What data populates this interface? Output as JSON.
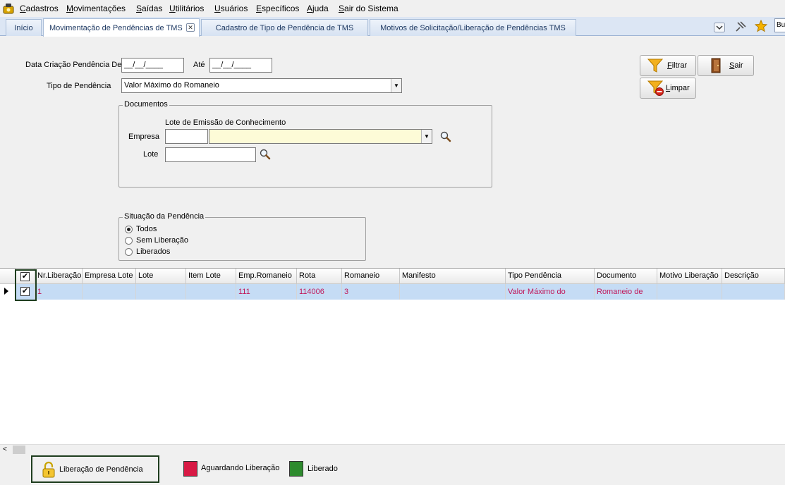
{
  "menu": {
    "items": [
      "Cadastros",
      "Movimentações",
      "Saídas",
      "Utilitários",
      "Usuários",
      "Específicos",
      "Ajuda",
      "Sair do Sistema"
    ]
  },
  "tabs": [
    {
      "label": "Início"
    },
    {
      "label": "Movimentação de Pendências de TMS"
    },
    {
      "label": "Cadastro de Tipo de Pendência de TMS"
    },
    {
      "label": "Motivos de Solicitação/Liberação de Pendências TMS"
    }
  ],
  "search": {
    "value": "Bu"
  },
  "form": {
    "date_label": "Data Criação Pendência De",
    "date_from": "__/__/____",
    "until_label": "Até",
    "date_to": "__/__/____",
    "type_label": "Tipo de Pendência",
    "type_value": "Valor Máximo do Romaneio",
    "documents_title": "Documentos",
    "lot_emission_label": "Lote de Emissão de Conhecimento",
    "company_label": "Empresa",
    "company_code": "",
    "company_name": "",
    "lot_label": "Lote",
    "lot_value": ""
  },
  "buttons": {
    "filter": "Filtrar",
    "exit": "Sair",
    "clear": "Limpar"
  },
  "situation": {
    "title": "Situação da Pendência",
    "options": [
      "Todos",
      "Sem Liberação",
      "Liberados"
    ],
    "selected": 0
  },
  "grid": {
    "columns": [
      "Nr.Liberação",
      "Empresa Lote",
      "Lote",
      "Item Lote",
      "Emp.Romaneio",
      "Rota",
      "Romaneio",
      "Manifesto",
      "Tipo Pendência",
      "Documento",
      "Motivo Liberação",
      "Descrição"
    ],
    "rows": [
      {
        "checked": true,
        "cells": [
          "1",
          "",
          "",
          "",
          "111",
          "114006",
          "3",
          "",
          "Valor Máximo do",
          "Romaneio de",
          "",
          ""
        ]
      }
    ]
  },
  "footer": {
    "release_button": "Liberação de Pendência",
    "legend_waiting": "Aguardando Liberação",
    "legend_released": "Liberado"
  },
  "colors": {
    "waiting": "#d81a45",
    "released": "#2e8b2e",
    "row_text": "#c0185a",
    "row_bg": "#c5dcf5",
    "highlight": "#1e3d1e"
  }
}
